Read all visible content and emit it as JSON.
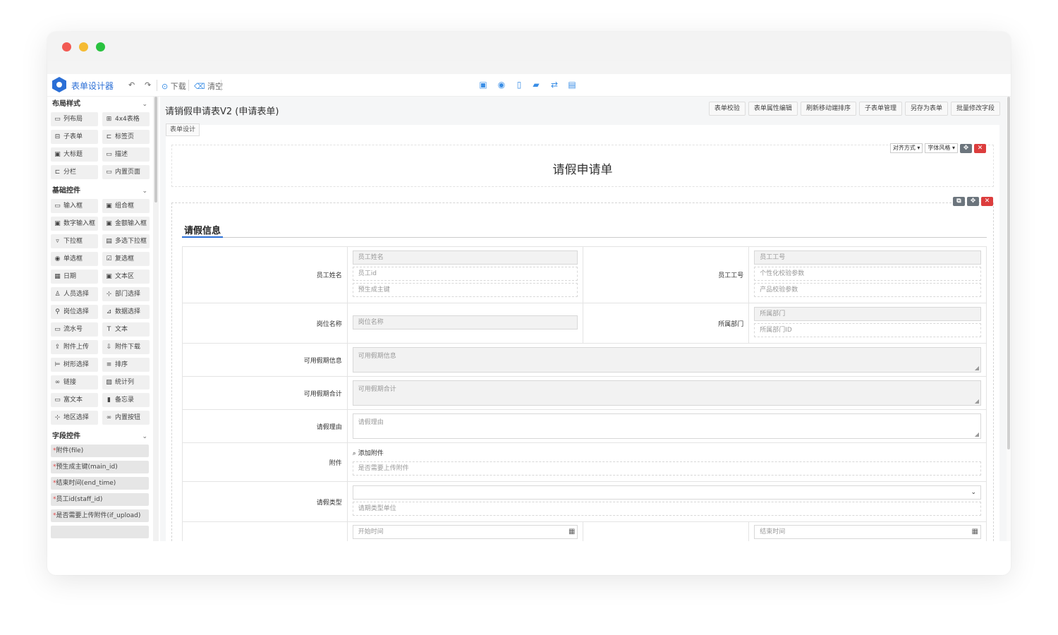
{
  "app": {
    "title": "表单设计器",
    "toolbar": {
      "download_label": "下载",
      "clear_label": "清空",
      "icons": [
        "undo-icon",
        "redo-icon",
        "save-icon",
        "preview-eye-icon",
        "mobile-icon",
        "book-icon",
        "swap-icon",
        "document-icon"
      ]
    },
    "accent_color": "#2b6fd6"
  },
  "sidebar": {
    "sections": [
      {
        "title": "布局样式",
        "items": [
          {
            "icon": "▭",
            "label": "列布局"
          },
          {
            "icon": "⊞",
            "label": "4x4表格"
          },
          {
            "icon": "⊟",
            "label": "子表单"
          },
          {
            "icon": "⊏",
            "label": "标签页"
          },
          {
            "icon": "▣",
            "label": "大标题"
          },
          {
            "icon": "▭",
            "label": "描述"
          },
          {
            "icon": "⊏",
            "label": "分栏"
          },
          {
            "icon": "▭",
            "label": "内置页面"
          }
        ]
      },
      {
        "title": "基础控件",
        "items": [
          {
            "icon": "▭",
            "label": "输入框"
          },
          {
            "icon": "▣",
            "label": "组合框"
          },
          {
            "icon": "▣",
            "label": "数字输入框"
          },
          {
            "icon": "▣",
            "label": "金额输入框"
          },
          {
            "icon": "▿",
            "label": "下拉框"
          },
          {
            "icon": "▤",
            "label": "多选下拉框"
          },
          {
            "icon": "◉",
            "label": "单选框"
          },
          {
            "icon": "☑",
            "label": "复选框"
          },
          {
            "icon": "▦",
            "label": "日期"
          },
          {
            "icon": "▣",
            "label": "文本区"
          },
          {
            "icon": "♙",
            "label": "人员选择"
          },
          {
            "icon": "⊹",
            "label": "部门选择"
          },
          {
            "icon": "⚲",
            "label": "岗位选择"
          },
          {
            "icon": "⊿",
            "label": "数据选择"
          },
          {
            "icon": "▭",
            "label": "流水号"
          },
          {
            "icon": "T",
            "label": "文本"
          },
          {
            "icon": "⇪",
            "label": "附件上传"
          },
          {
            "icon": "⇩",
            "label": "附件下载"
          },
          {
            "icon": "⊨",
            "label": "树形选择"
          },
          {
            "icon": "≡",
            "label": "排序"
          },
          {
            "icon": "∞",
            "label": "链接"
          },
          {
            "icon": "▨",
            "label": "统计列"
          },
          {
            "icon": "▭",
            "label": "富文本"
          },
          {
            "icon": "▮",
            "label": "备忘录"
          },
          {
            "icon": "⊹",
            "label": "地区选择"
          },
          {
            "icon": "∞",
            "label": "内置按钮"
          }
        ]
      },
      {
        "title": "字段控件",
        "fields": [
          "附件(file)",
          "预生成主键(main_id)",
          "结束时间(end_time)",
          "员工id(staff_id)",
          "是否需要上传附件(if_upload)"
        ]
      }
    ]
  },
  "main": {
    "form_name": "请销假申请表V2 (申请表单)",
    "top_buttons": [
      "表单校验",
      "表单属性编辑",
      "刷新移动端排序",
      "子表单管理",
      "另存为表单",
      "批量修改字段"
    ],
    "tab": "表单设计",
    "header": {
      "title": "请假申请单",
      "align_label": "对齐方式",
      "font_label": "字体风格"
    },
    "section_title": "请假信息",
    "rows": {
      "staff_name_label": "员工姓名",
      "staff_name_ph": "员工姓名",
      "staff_id_ph": "员工id",
      "pre_key_ph": "预生成主键",
      "staff_no_label": "员工工号",
      "staff_no_ph": "员工工号",
      "custom_param_ph": "个性化校验参数",
      "product_param_ph": "产品校验参数",
      "post_label": "岗位名称",
      "post_ph": "岗位名称",
      "dept_label": "所属部门",
      "dept_ph": "所属部门",
      "dept_id_ph": "所属部门ID",
      "vacation_info_label": "可用假期信息",
      "vacation_info_ph": "可用假期信息",
      "vacation_total_label": "可用假期合计",
      "vacation_total_ph": "可用假期合计",
      "reason_label": "请假理由",
      "reason_ph": "请假理由",
      "attach_label": "附件",
      "add_attach": "添加附件",
      "need_upload_ph": "是否需要上传附件",
      "leave_type_label": "请假类型",
      "leave_unit_ph": "请期类型单位",
      "start_ph": "开始时间",
      "end_ph": "结束时间"
    }
  }
}
